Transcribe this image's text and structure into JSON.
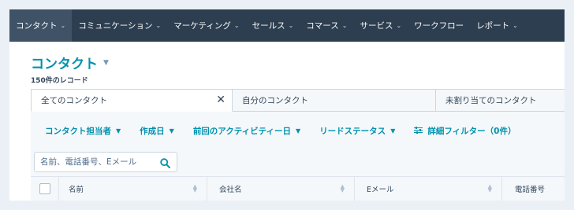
{
  "topnav": {
    "items": [
      {
        "label": "コンタクト",
        "active": true
      },
      {
        "label": "コミュニケーション",
        "active": false
      },
      {
        "label": "マーケティング",
        "active": false
      },
      {
        "label": "セールス",
        "active": false
      },
      {
        "label": "コマース",
        "active": false
      },
      {
        "label": "サービス",
        "active": false
      },
      {
        "label": "ワークフロー",
        "active": false
      },
      {
        "label": "レポート",
        "active": false
      }
    ]
  },
  "header": {
    "title": "コンタクト",
    "record_count": "150件のレコード"
  },
  "tabs": [
    {
      "label": "全てのコンタクト",
      "active": true
    },
    {
      "label": "自分のコンタクト",
      "active": false
    },
    {
      "label": "未割り当てのコンタクト",
      "active": false
    }
  ],
  "filters": {
    "owner": "コンタクト担当者",
    "created": "作成日",
    "last_activity": "前回のアクティビティー日",
    "lead_status": "リードステータス",
    "advanced": "詳細フィルター（0件）"
  },
  "search": {
    "placeholder": "名前、電話番号、Eメール"
  },
  "table": {
    "columns": [
      "名前",
      "会社名",
      "Eメール",
      "電話番号"
    ]
  },
  "colors": {
    "nav_bg": "#2d3e50",
    "accent": "#0091ae",
    "text": "#33475b",
    "panel_bg": "#f5f8fa"
  }
}
